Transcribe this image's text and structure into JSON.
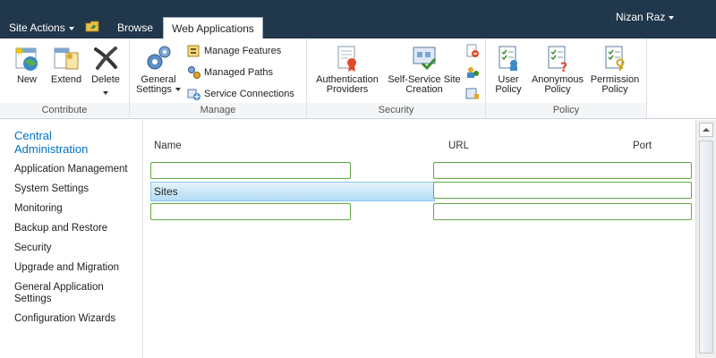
{
  "topbar": {
    "site_actions": "Site Actions",
    "browse_tab": "Browse",
    "active_tab": "Web Applications",
    "user_name": "Nizan Raz"
  },
  "ribbon": {
    "contribute": {
      "label": "Contribute",
      "new": "New",
      "extend": "Extend",
      "delete": "Delete"
    },
    "manage": {
      "label": "Manage",
      "general_settings_1": "General",
      "general_settings_2": "Settings",
      "manage_features": "Manage Features",
      "managed_paths": "Managed Paths",
      "service_connections": "Service Connections"
    },
    "security": {
      "label": "Security",
      "auth_providers_1": "Authentication",
      "auth_providers_2": "Providers",
      "self_service_1": "Self-Service Site",
      "self_service_2": "Creation"
    },
    "policy": {
      "label": "Policy",
      "user_policy_1": "User",
      "user_policy_2": "Policy",
      "anon_policy_1": "Anonymous",
      "anon_policy_2": "Policy",
      "perm_policy_1": "Permission",
      "perm_policy_2": "Policy"
    }
  },
  "leftnav": {
    "title_1": "Central",
    "title_2": "Administration",
    "items": [
      "Application Management",
      "System Settings",
      "Monitoring",
      "Backup and Restore",
      "Security",
      "Upgrade and Migration",
      "General Application Settings",
      "Configuration Wizards"
    ]
  },
  "main": {
    "columns": {
      "name": "Name",
      "url": "URL",
      "port": "Port"
    },
    "selected_row": "Sites"
  },
  "colors": {
    "topbar": "#21374c",
    "field_border": "#62a844",
    "nav_title": "#0072c6",
    "selection": "#b3ddf7"
  }
}
